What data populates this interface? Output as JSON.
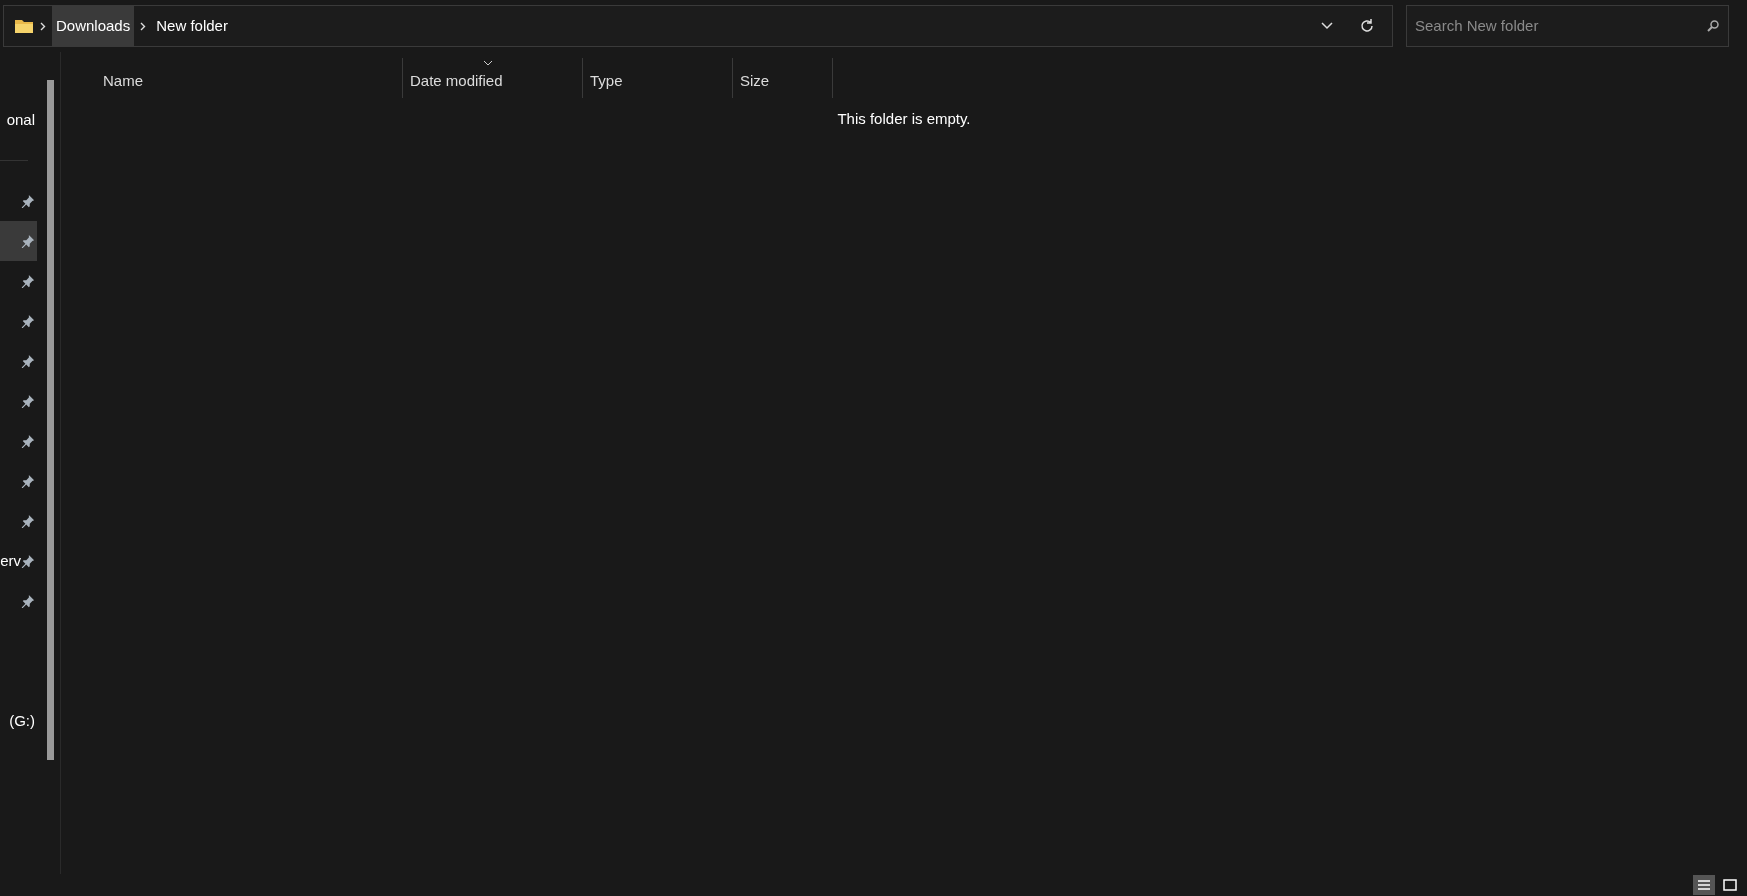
{
  "address_bar": {
    "breadcrumbs": [
      {
        "label": "Downloads",
        "selected": true
      },
      {
        "label": "New folder",
        "selected": false
      }
    ]
  },
  "search": {
    "placeholder": "Search New folder"
  },
  "sidebar": {
    "sections": [
      {
        "items": [
          {
            "kind": "item",
            "label": "onal",
            "pinned": false,
            "selected": false
          }
        ]
      },
      {
        "items": [
          {
            "kind": "item",
            "pinned": true,
            "selected": false
          },
          {
            "kind": "item",
            "pinned": true,
            "selected": true
          },
          {
            "kind": "item",
            "pinned": true,
            "selected": false
          },
          {
            "kind": "item",
            "pinned": true,
            "selected": false
          },
          {
            "kind": "item",
            "pinned": true,
            "selected": false
          },
          {
            "kind": "item",
            "pinned": true,
            "selected": false
          },
          {
            "kind": "item",
            "pinned": true,
            "selected": false
          },
          {
            "kind": "item",
            "pinned": true,
            "selected": false
          },
          {
            "kind": "item",
            "pinned": true,
            "selected": false
          },
          {
            "kind": "item",
            "label": "erv",
            "pinned": true,
            "selected": false
          },
          {
            "kind": "item",
            "pinned": true,
            "selected": false
          },
          {
            "kind": "spacer"
          },
          {
            "kind": "spacer"
          },
          {
            "kind": "item",
            "label": "(G:)",
            "pinned": false,
            "selected": false
          }
        ]
      }
    ]
  },
  "table": {
    "columns": [
      {
        "label": "Name",
        "sorted": false
      },
      {
        "label": "Date modified",
        "sorted": true
      },
      {
        "label": "Type",
        "sorted": false
      },
      {
        "label": "Size",
        "sorted": false
      }
    ],
    "empty_message": "This folder is empty."
  },
  "status_bar": {
    "views": [
      {
        "kind": "details",
        "selected": true
      },
      {
        "kind": "tiles",
        "selected": false
      }
    ]
  }
}
